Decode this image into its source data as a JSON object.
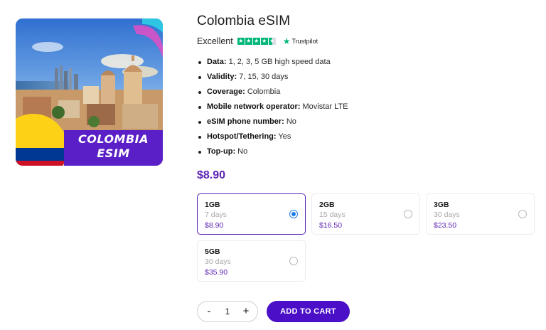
{
  "product": {
    "title": "Colombia eSIM",
    "image_label_line1": "COLOMBIA",
    "image_label_line2": "ESIM",
    "image_colors": {
      "flag_yellow": "#fcd116",
      "flag_blue": "#003893",
      "flag_red": "#ce1126",
      "banner": "#5a1fc6"
    }
  },
  "rating": {
    "label": "Excellent",
    "stars": 4.5,
    "provider": "Trustpilot",
    "star_color": "#00b67a"
  },
  "features": [
    {
      "key": "Data:",
      "value": "1, 2, 3, 5 GB high speed data"
    },
    {
      "key": "Validity:",
      "value": "7, 15, 30 days"
    },
    {
      "key": "Coverage:",
      "value": "Colombia"
    },
    {
      "key": "Mobile network operator:",
      "value": "Movistar LTE"
    },
    {
      "key": "eSIM phone number:",
      "value": "No"
    },
    {
      "key": "Hotspot/Tethering:",
      "value": "Yes"
    },
    {
      "key": "Top-up:",
      "value": "No"
    }
  ],
  "price": "$8.90",
  "variants": [
    {
      "name": "1GB",
      "days": "7 days",
      "price": "$8.90",
      "selected": true
    },
    {
      "name": "2GB",
      "days": "15 days",
      "price": "$16.50",
      "selected": false
    },
    {
      "name": "3GB",
      "days": "30 days",
      "price": "$23.50",
      "selected": false
    },
    {
      "name": "5GB",
      "days": "30 days",
      "price": "$35.90",
      "selected": false
    }
  ],
  "quantity": {
    "minus": "-",
    "value": "1",
    "plus": "+"
  },
  "cart_button": "ADD TO CART",
  "colors": {
    "accent": "#5b24b3",
    "cart_bg": "#4b0fc8",
    "radio_checked": "#1a7de6"
  }
}
